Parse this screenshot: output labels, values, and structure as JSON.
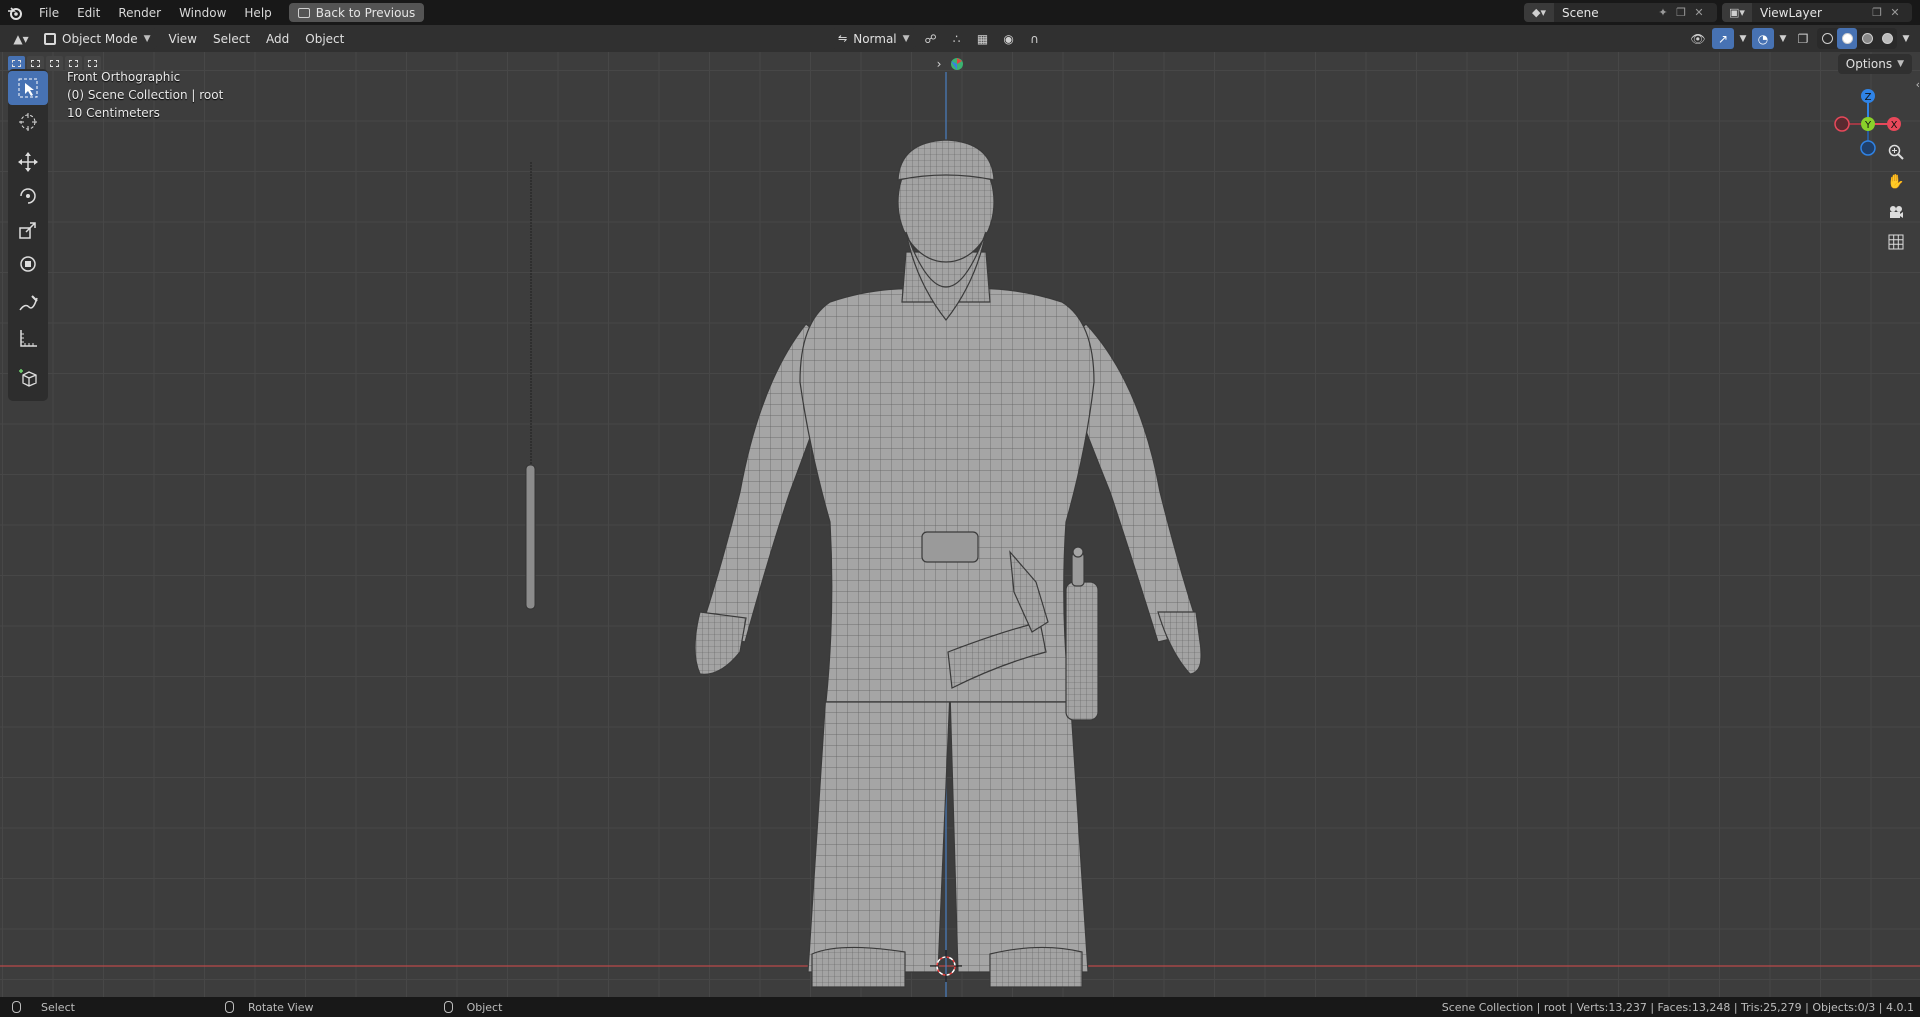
{
  "topbar": {
    "menu": [
      "File",
      "Edit",
      "Render",
      "Window",
      "Help"
    ],
    "back_button": "Back to Previous",
    "scene_name": "Scene",
    "view_layer": "ViewLayer"
  },
  "header": {
    "mode": "Object Mode",
    "menus": [
      "View",
      "Select",
      "Add",
      "Object"
    ],
    "orientation": "Normal",
    "options": "Options"
  },
  "viewport": {
    "view_name": "Front Orthographic",
    "collection": "(0) Scene Collection | root",
    "scale": "10 Centimeters",
    "gizmo": {
      "z": "Z",
      "y": "Y",
      "x": "X"
    }
  },
  "statusbar": {
    "select": "Select",
    "rotate": "Rotate View",
    "object": "Object",
    "stats": "Scene Collection | root | Verts:13,237 | Faces:13,248 | Tris:25,279 | Objects:0/3 | 4.0.1"
  },
  "colors": {
    "accent": "#4772b3",
    "axis_x": "#e8485a",
    "axis_y": "#8ad12a",
    "axis_z": "#2f83e6",
    "viewport_bg": "#3d3d3d"
  },
  "icons": [
    "blender-logo-icon",
    "select-box-icon",
    "cursor-icon",
    "move-icon",
    "rotate-icon",
    "scale-icon",
    "transform-icon",
    "annotate-icon",
    "measure-icon",
    "add-cube-icon",
    "zoom-icon",
    "hand-icon",
    "camera-icon",
    "grid-icon"
  ]
}
